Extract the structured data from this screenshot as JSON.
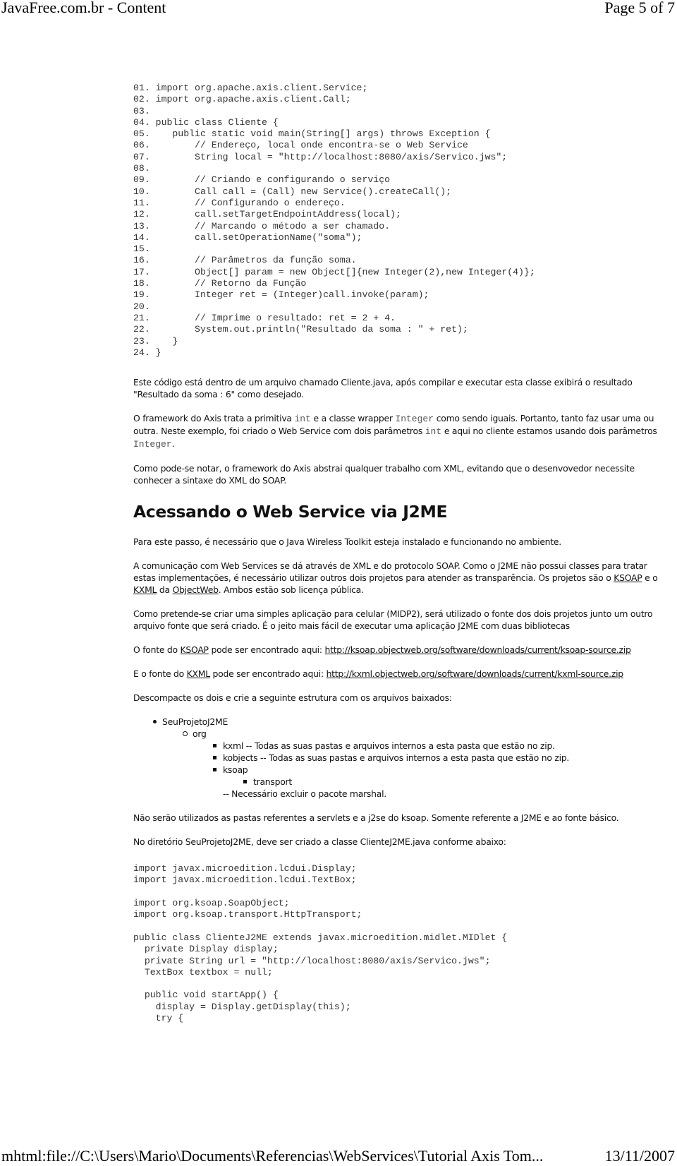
{
  "header": {
    "title": "JavaFree.com.br - Content",
    "page_indicator": "Page 5 of 7"
  },
  "code_block_1": [
    "01. import org.apache.axis.client.Service;",
    "02. import org.apache.axis.client.Call;",
    "03.",
    "04. public class Cliente {",
    "05.    public static void main(String[] args) throws Exception {",
    "06.        // Endereço, local onde encontra-se o Web Service",
    "07.        String local = \"http://localhost:8080/axis/Servico.jws\";",
    "08.",
    "09.        // Criando e configurando o serviço",
    "10.        Call call = (Call) new Service().createCall();",
    "11.        // Configurando o endereço.",
    "12.        call.setTargetEndpointAddress(local);",
    "13.        // Marcando o método a ser chamado.",
    "14.        call.setOperationName(\"soma\");",
    "15.",
    "16.        // Parâmetros da função soma.",
    "17.        Object[] param = new Object[]{new Integer(2),new Integer(4)};",
    "18.        // Retorno da Função",
    "19.        Integer ret = (Integer)call.invoke(param);",
    "20.",
    "21.        // Imprime o resultado: ret = 2 + 4.",
    "22.        System.out.println(\"Resultado da soma : \" + ret);",
    "23.    }",
    "24. }"
  ],
  "para_1": "Este código está dentro de um arquivo chamado Cliente.java, após compilar e executar esta classe exibirá o resultado \"Resultado da soma : 6\" como desejado.",
  "para_2": {
    "t1": "O framework do Axis trata a primitiva ",
    "c1": "int",
    "t2": " e a classe wrapper ",
    "c2": "Integer",
    "t3": " como sendo iguais. Portanto, tanto faz usar uma ou outra. Neste exemplo, foi criado o Web Service com dois parâmetros ",
    "c3": "int",
    "t4": " e aqui no cliente estamos usando dois parâmetros ",
    "c4": "Integer",
    "t5": "."
  },
  "para_3": "Como pode-se notar, o framework do Axis abstrai qualquer trabalho com XML, evitando que o desenvovedor necessite conhecer a sintaxe do XML do SOAP.",
  "section_title": "Acessando o Web Service via J2ME",
  "para_4": "Para este passo, é necessário que o Java Wireless Toolkit esteja instalado e funcionando no ambiente.",
  "para_5": {
    "t1": "A comunicação com Web Services se dá através de XML e do protocolo SOAP. Como o J2ME não possui classes para tratar estas implementações, é necessário utilizar outros dois projetos para atender as transparência. Os projetos são o ",
    "link_ksoap": "KSOAP",
    "t2": " e o ",
    "link_kxml": "KXML",
    "t3": " da ",
    "link_objectweb": "ObjectWeb",
    "t4": ". Ambos estão sob licença pública."
  },
  "para_6": "Como pretende-se criar uma simples aplicação para celular (MIDP2), será utilizado o fonte dos dois projetos junto um outro arquivo fonte que será criado. É o jeito mais fácil de executar uma aplicação J2ME com duas bibliotecas",
  "para_7": {
    "t1": "O fonte do ",
    "link_name": "KSOAP",
    "t2": " pode ser encontrado aqui: ",
    "link_url": "http://ksoap.objectweb.org/software/downloads/current/ksoap-source.zip"
  },
  "para_8": {
    "t1": "E o fonte do ",
    "link_name": "KXML",
    "t2": " pode ser encontrado aqui: ",
    "link_url": "http://kxml.objectweb.org/software/downloads/current/kxml-source.zip"
  },
  "para_9": "Descompacte os dois e crie a seguinte estrutura com os arquivos baixados:",
  "tree": {
    "root": "SeuProjetoJ2ME",
    "org": "org",
    "kxml": "kxml -- Todas as suas pastas e arquivos internos a esta pasta que estão no zip.",
    "kobjects": "kobjects -- Todas as suas pastas e arquivos internos a esta pasta que estão no zip.",
    "ksoap": "ksoap",
    "transport": "transport",
    "note": "-- Necessário excluir o pacote marshal."
  },
  "para_10": "Não serão utilizados as pastas referentes a servlets e a j2se do ksoap. Somente referente a J2ME e ao fonte básico.",
  "para_11": "No diretório SeuProjetoJ2ME, deve ser criado a classe ClienteJ2ME.java conforme abaixo:",
  "code_block_2": [
    "import javax.microedition.lcdui.Display;",
    "import javax.microedition.lcdui.TextBox;",
    "",
    "import org.ksoap.SoapObject;",
    "import org.ksoap.transport.HttpTransport;",
    "",
    "public class ClienteJ2ME extends javax.microedition.midlet.MIDlet {",
    "  private Display display;",
    "  private String url = \"http://localhost:8080/axis/Servico.jws\";",
    "  TextBox textbox = null;",
    "",
    "  public void startApp() {",
    "    display = Display.getDisplay(this);",
    "    try {"
  ],
  "footer": {
    "path": "mhtml:file://C:\\Users\\Mario\\Documents\\Referencias\\WebServices\\Tutorial Axis Tom...",
    "date": "13/11/2007"
  }
}
